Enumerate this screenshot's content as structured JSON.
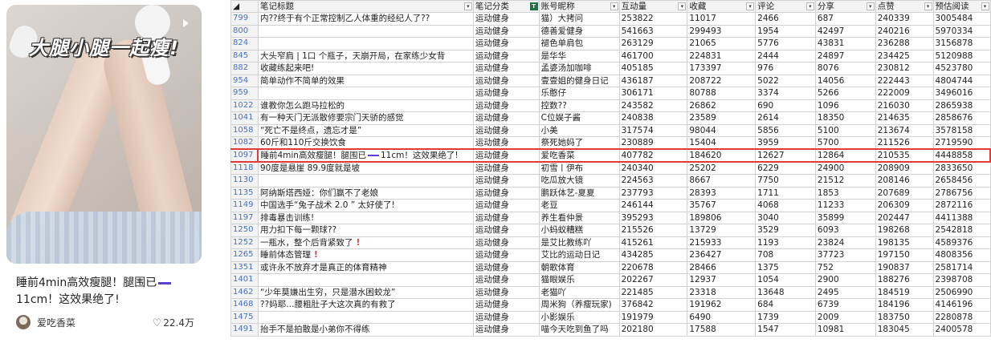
{
  "card": {
    "cover_caption": "大腿小腿一起瘦!",
    "title_before": "睡前4min高效瘦腿！腿围已",
    "title_after": "11cm！这效果绝了!",
    "author": "爱吃香菜",
    "likes": "22.4万",
    "heart_icon": "heart-outline-icon"
  },
  "sheet": {
    "columns": [
      "笔记标题",
      "笔记分类",
      "账号昵称",
      "互动量",
      "收藏",
      "评论",
      "分享",
      "点赞",
      "预估阅读"
    ],
    "rows": [
      {
        "n": "799",
        "title": "内??终于有个正常控制乙人体重的经纪人了??",
        "cat": "运动健身",
        "acct": "猫）大拷问",
        "inter": "253822",
        "fav": "11017",
        "cmt": "2466",
        "share": "687",
        "like": "240339",
        "read": "3005484"
      },
      {
        "n": "800",
        "title": "",
        "cat": "运动健身",
        "acct": "德善爱健身",
        "inter": "541663",
        "fav": "299493",
        "cmt": "1954",
        "share": "42497",
        "like": "240216",
        "read": "5970334"
      },
      {
        "n": "824",
        "title": "",
        "cat": "运动健身",
        "acct": "褪色单肩包",
        "inter": "263129",
        "fav": "21065",
        "cmt": "5776",
        "share": "43831",
        "like": "236288",
        "read": "3156878"
      },
      {
        "n": "845",
        "title": "大头窄肩 | 1口 个瓶子，天崩开局，在家练少女背",
        "cat": "运动健身",
        "acct": "是华华",
        "inter": "461700",
        "fav": "224831",
        "cmt": "2444",
        "share": "24897",
        "like": "234425",
        "read": "5120988"
      },
      {
        "n": "882",
        "title": "收藏练起来吧!",
        "cat": "运动健身",
        "acct": "孟婆汤加咖啡",
        "inter": "405185",
        "fav": "173397",
        "cmt": "976",
        "share": "8076",
        "like": "230812",
        "read": "4523780"
      },
      {
        "n": "954",
        "title": "简单动作不简单的效果",
        "cat": "运动健身",
        "acct": "壹壹姐的健身日记",
        "inter": "436187",
        "fav": "208722",
        "cmt": "5022",
        "share": "14056",
        "like": "222443",
        "read": "4804744"
      },
      {
        "n": "959",
        "title": "",
        "cat": "运动健身",
        "acct": "乐憨仔",
        "inter": "306171",
        "fav": "80788",
        "cmt": "3374",
        "share": "5266",
        "like": "222009",
        "read": "3496016"
      },
      {
        "n": "1022",
        "title": "谁教你怎么跑马拉松的",
        "cat": "运动健身",
        "acct": "控数??",
        "inter": "243582",
        "fav": "26862",
        "cmt": "690",
        "share": "1096",
        "like": "216030",
        "read": "2865938"
      },
      {
        "n": "1041",
        "title": "有一种天门无派散修要宗门天骄的感觉",
        "cat": "运动健身",
        "acct": "C位娱子酱",
        "inter": "240838",
        "fav": "23589",
        "cmt": "2614",
        "share": "18350",
        "like": "214635",
        "read": "2858676"
      },
      {
        "n": "1058",
        "title": "“死亡不是终点，遗忘才是”",
        "cat": "运动健身",
        "acct": "小美",
        "inter": "317574",
        "fav": "98044",
        "cmt": "5856",
        "share": "5100",
        "like": "213674",
        "read": "3578158"
      },
      {
        "n": "1082",
        "title": "60斤和110斤交换饮食",
        "cat": "运动健身",
        "acct": "祭死她妈了",
        "inter": "230889",
        "fav": "15404",
        "cmt": "3959",
        "share": "5700",
        "like": "211526",
        "read": "2719590"
      },
      {
        "n": "1097",
        "title_before": "睡前4min高效瘦腿！腿围已",
        "title_after": "11cm！这效果绝了!",
        "cat": "运动健身",
        "acct": "爱吃香菜",
        "inter": "407782",
        "fav": "184620",
        "cmt": "12627",
        "share": "12864",
        "like": "210535",
        "read": "4448858",
        "highlight": true
      },
      {
        "n": "1118",
        "title": "90度是悬崖 89.9度就是坡",
        "cat": "运动健身",
        "acct": "初雪丨伊布",
        "inter": "240340",
        "fav": "25202",
        "cmt": "6229",
        "share": "24900",
        "like": "208909",
        "read": "2833650"
      },
      {
        "n": "1130",
        "title": "",
        "cat": "运动健身",
        "acct": "吃瓜放大镜",
        "inter": "224563",
        "fav": "8667",
        "cmt": "7750",
        "share": "21512",
        "like": "208146",
        "read": "2658456"
      },
      {
        "n": "1135",
        "title": "阿纳斯塔西娅：你们赢不了老娘",
        "cat": "运动健身",
        "acct": "鹏跃体艺-夏夏",
        "inter": "237793",
        "fav": "28393",
        "cmt": "1711",
        "share": "1853",
        "like": "207689",
        "read": "2786756"
      },
      {
        "n": "1149",
        "title": "中国选手“兔子战术 2.0 ” 太好使了!",
        "cat": "运动健身",
        "acct": "老豆",
        "inter": "246144",
        "fav": "35767",
        "cmt": "4068",
        "share": "11233",
        "like": "206309",
        "read": "2872116"
      },
      {
        "n": "1197",
        "title": "排毒暴击训练!",
        "cat": "运动健身",
        "acct": "养生看仲景",
        "inter": "395293",
        "fav": "189806",
        "cmt": "3040",
        "share": "35899",
        "like": "202447",
        "read": "4411388"
      },
      {
        "n": "1250",
        "title": "用力扣下每一颗球??",
        "cat": "运动健身",
        "acct": "小蚂蚁糟糕",
        "inter": "215526",
        "fav": "13729",
        "cmt": "3529",
        "share": "6093",
        "like": "198268",
        "read": "2542818"
      },
      {
        "n": "1252",
        "title": "一瓶水，整个后背紧致了",
        "cat": "运动健身",
        "acct": "是艾比教练吖",
        "inter": "415261",
        "fav": "215933",
        "cmt": "1193",
        "share": "23824",
        "like": "198135",
        "read": "4589376",
        "excl": "!"
      },
      {
        "n": "1265",
        "title": "睡前体态管理",
        "cat": "运动健身",
        "acct": "艾比的运动日记",
        "inter": "434285",
        "fav": "236427",
        "cmt": "708",
        "share": "37723",
        "like": "197150",
        "read": "4808356",
        "excl": "!"
      },
      {
        "n": "1351",
        "title": "或许永不放弃才是真正的体育精神",
        "cat": "运动健身",
        "acct": "朝歌体育",
        "inter": "220678",
        "fav": "28466",
        "cmt": "1375",
        "share": "752",
        "like": "190837",
        "read": "2581714"
      },
      {
        "n": "1401",
        "title": "",
        "cat": "运动健身",
        "acct": "猫眼娱乐",
        "inter": "202267",
        "fav": "12937",
        "cmt": "1054",
        "share": "2900",
        "like": "188276",
        "read": "2398708"
      },
      {
        "n": "1462",
        "title": "“少年莫嫌出生穷，只是潜水困蛟龙”",
        "cat": "运动健身",
        "acct": "老猫吖",
        "inter": "221485",
        "fav": "23318",
        "cmt": "13648",
        "share": "2495",
        "like": "184519",
        "read": "2506990"
      },
      {
        "n": "1468",
        "title": "??妈耶…腰粗肚子大这次真的有救了",
        "cat": "运动健身",
        "acct": "周米狗（养瘦玩家)",
        "inter": "376842",
        "fav": "191962",
        "cmt": "684",
        "share": "6739",
        "like": "184196",
        "read": "4146196"
      },
      {
        "n": "1475",
        "title": "",
        "cat": "运动健身",
        "acct": "小影娱乐",
        "inter": "191979",
        "fav": "6490",
        "cmt": "1739",
        "share": "2009",
        "like": "183750",
        "read": "2280878"
      },
      {
        "n": "1491",
        "title": "抬手不是拍散是小弟你不得练",
        "cat": "运动健身",
        "acct": "喵今天吃到鱼了吗",
        "inter": "202180",
        "fav": "17588",
        "cmt": "1547",
        "share": "10981",
        "like": "183045",
        "read": "2400578"
      }
    ]
  }
}
